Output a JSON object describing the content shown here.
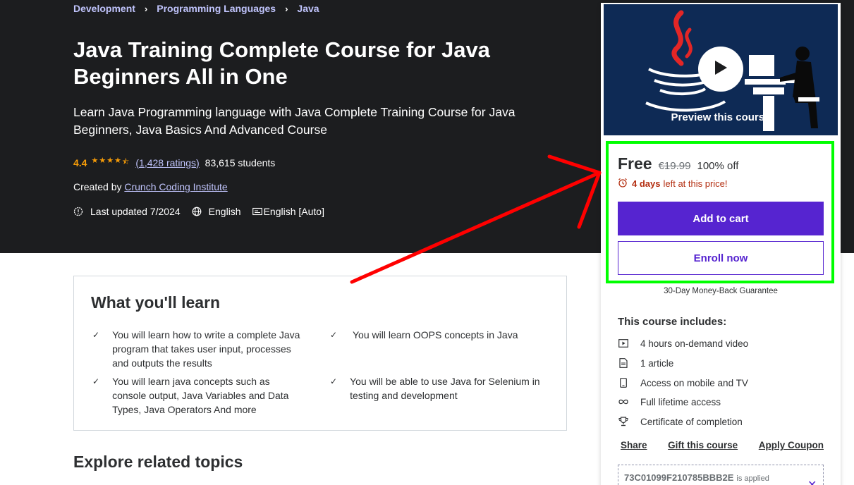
{
  "breadcrumb": [
    "Development",
    "Programming Languages",
    "Java"
  ],
  "course": {
    "title": "Java Training Complete Course for Java Beginners All in One",
    "subtitle": "Learn Java Programming language with Java Complete Training Course for Java Beginners, Java Basics And Advanced Course",
    "rating": "4.4",
    "stars": 4.4,
    "ratings_count": "(1,428 ratings)",
    "students": "83,615 students",
    "created_by_label": "Created by",
    "instructor": "Crunch Coding Institute",
    "last_updated": "Last updated 7/2024",
    "language": "English",
    "captions": "English [Auto]"
  },
  "learn": {
    "title": "What you'll learn",
    "items": [
      "You will learn how to write a complete Java program that takes user input, processes and outputs the results",
      "You will learn OOPS concepts in Java",
      "You will learn java concepts such as console output, Java Variables and Data Types, Java Operators And more",
      "You will be able to use Java for Selenium in testing and development"
    ]
  },
  "explore_title": "Explore related topics",
  "sidebar": {
    "preview_label": "Preview this course",
    "price": "Free",
    "original_price": "€19.99",
    "discount": "100% off",
    "timer_days": "4 days",
    "timer_text": "left at this price!",
    "add_to_cart": "Add to cart",
    "enroll_now": "Enroll now",
    "guarantee": "30-Day Money-Back Guarantee",
    "includes_title": "This course includes:",
    "includes": [
      {
        "icon": "video-icon",
        "label": "4 hours on-demand video"
      },
      {
        "icon": "article-icon",
        "label": "1 article"
      },
      {
        "icon": "mobile-icon",
        "label": "Access on mobile and TV"
      },
      {
        "icon": "infinity-icon",
        "label": "Full lifetime access"
      },
      {
        "icon": "trophy-icon",
        "label": "Certificate of completion"
      }
    ],
    "links": [
      "Share",
      "Gift this course",
      "Apply Coupon"
    ],
    "coupon_code": "73C01099F210785BBB2E",
    "coupon_applied": "is applied"
  },
  "colors": {
    "hero_bg": "#1c1d1f",
    "accent": "#5624d0",
    "link": "#c0c4fc",
    "star": "#f69c08",
    "timer": "#b32d0f",
    "highlight": "#00ff00",
    "arrow": "#ff0000"
  }
}
